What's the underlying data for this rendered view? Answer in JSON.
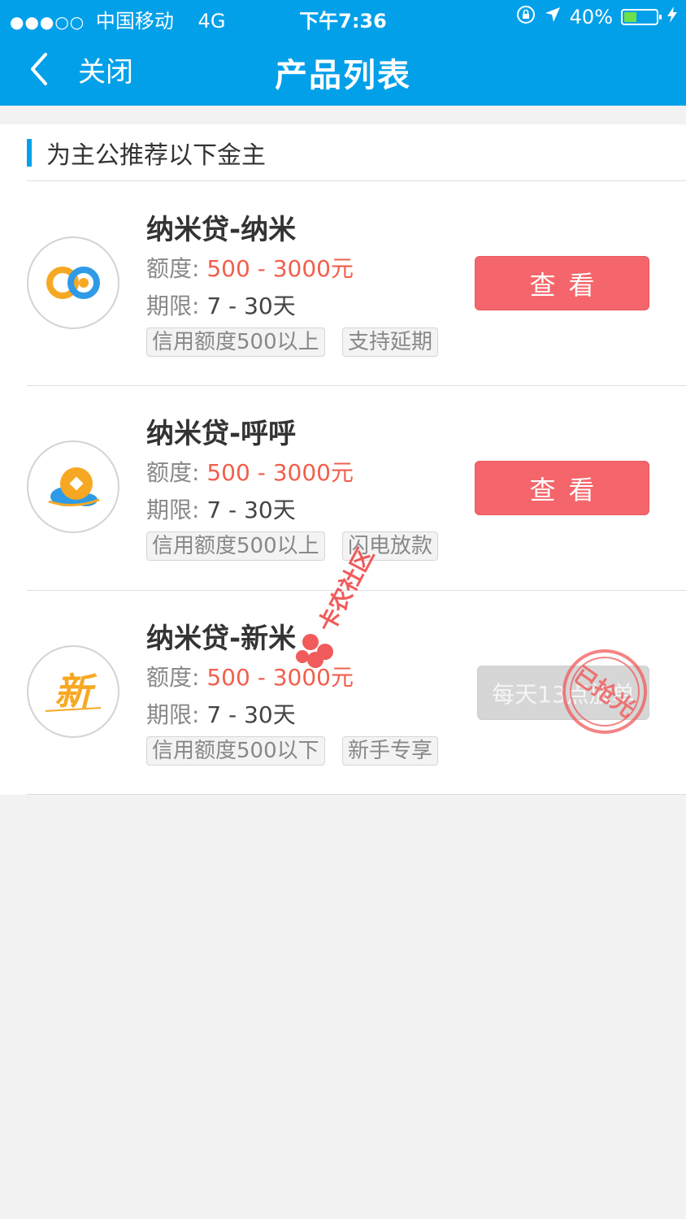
{
  "status_bar": {
    "signal": "●●●○○",
    "carrier": "中国移动",
    "network": "4G",
    "time": "下午7:36",
    "battery_percent": "40%",
    "battery_level": 0.4
  },
  "nav": {
    "back_label": "关闭",
    "title": "产品列表"
  },
  "section": {
    "heading": "为主公推荐以下金主"
  },
  "products": [
    {
      "name": "纳米贷-纳米",
      "amount_label": "额度:",
      "amount_value": "500 - 3000元",
      "term_label": "期限:",
      "term_value": "7 - 30天",
      "tags": [
        "信用额度500以上",
        "支持延期"
      ],
      "action": "查看",
      "logo_icon": "infinity-coins-icon"
    },
    {
      "name": "纳米贷-呼呼",
      "amount_label": "额度:",
      "amount_value": "500 - 3000元",
      "term_label": "期限:",
      "term_value": "7 - 30天",
      "tags": [
        "信用额度500以上",
        "闪电放款"
      ],
      "action": "查看",
      "logo_icon": "gold-coin-icon"
    },
    {
      "name": "纳米贷-新米",
      "amount_label": "额度:",
      "amount_value": "500 - 3000元",
      "term_label": "期限:",
      "term_value": "7 - 30天",
      "tags": [
        "信用额度500以下",
        "新手专享"
      ],
      "action": "每天13点放单",
      "action_disabled": true,
      "stamp": "已抢光",
      "logo_icon": "xin-character-icon",
      "logo_text": "新"
    }
  ],
  "watermark": "卡农社区",
  "colors": {
    "brand_blue": "#03a0ea",
    "button_red": "#f4666b",
    "amount_red": "#f15f4c",
    "disabled_gray": "#d6d6d6"
  }
}
